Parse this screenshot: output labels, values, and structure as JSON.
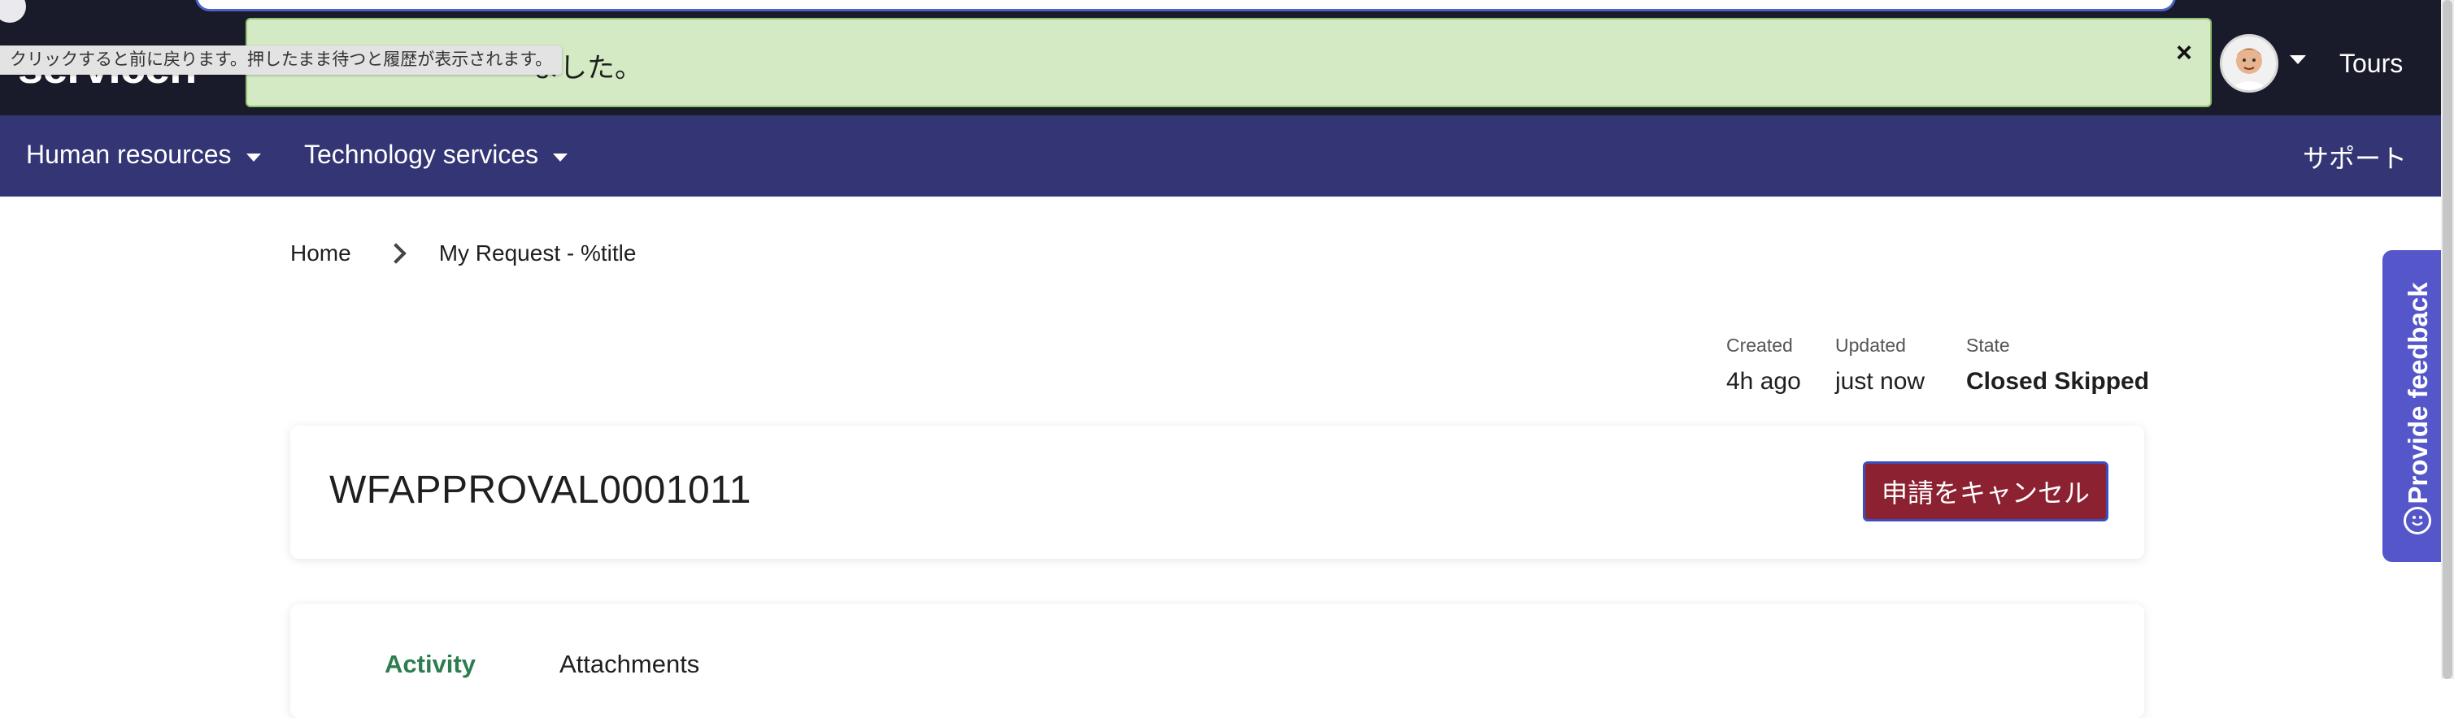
{
  "header": {
    "logo_text": "servicen",
    "back_tooltip": "クリックすると前に戻ります。押したまま待つと履歴が表示されます。",
    "toast_message": "ました。",
    "toast_close": "×",
    "tours_label": "Tours"
  },
  "nav": {
    "items": [
      {
        "label": "Human resources"
      },
      {
        "label": "Technology services"
      }
    ],
    "support_label": "サポート"
  },
  "breadcrumb": {
    "home": "Home",
    "current": "My Request - %title"
  },
  "meta": {
    "created_label": "Created",
    "created_value": "4h ago",
    "updated_label": "Updated",
    "updated_value": "just now",
    "state_label": "State",
    "state_value": "Closed Skipped"
  },
  "request": {
    "number": "WFAPPROVAL0001011",
    "cancel_label": "申請をキャンセル"
  },
  "tabs": [
    {
      "label": "Activity",
      "active": true
    },
    {
      "label": "Attachments",
      "active": false
    }
  ],
  "feedback": {
    "label": "Provide feedback"
  },
  "colors": {
    "header_bg": "#1a1b2a",
    "nav_bg": "#343575",
    "toast_bg": "#d4eac4",
    "cancel_bg": "#8c2132",
    "feedback_bg": "#5456c9",
    "active_tab": "#2e7d4f"
  }
}
